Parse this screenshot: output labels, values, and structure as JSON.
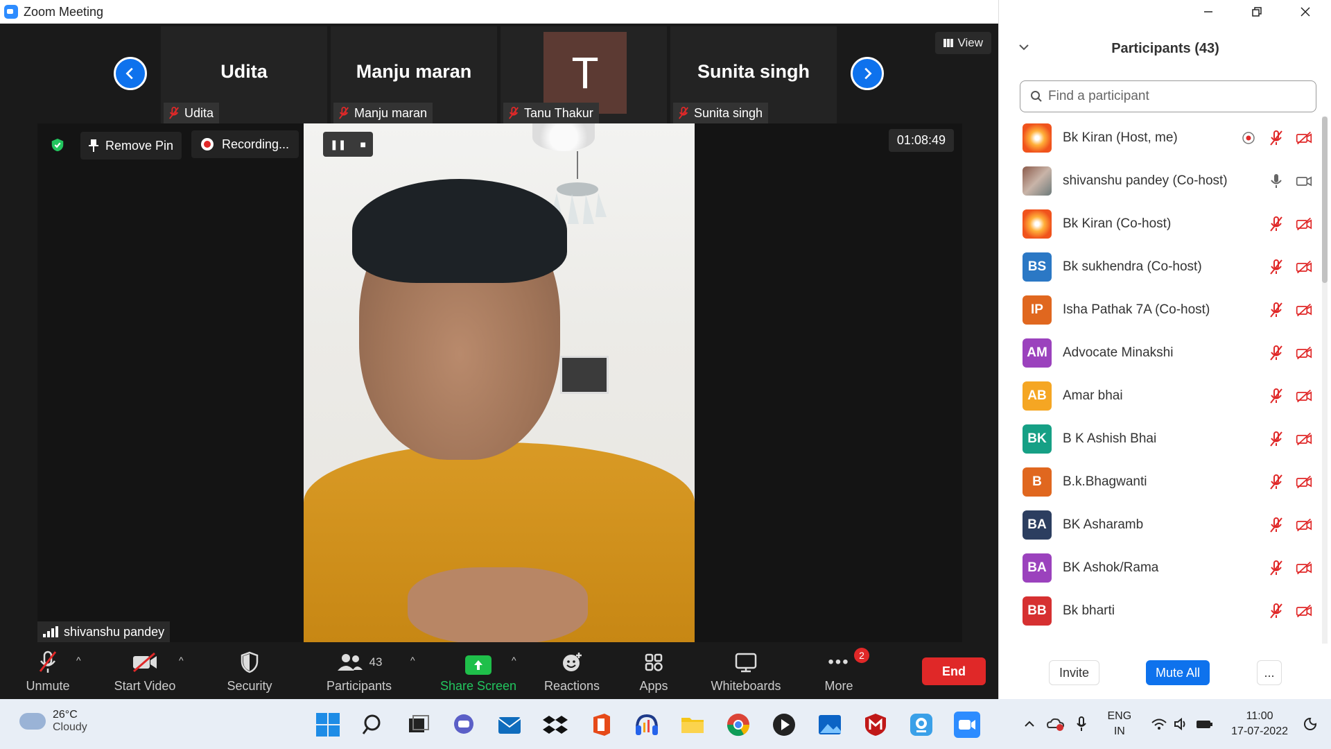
{
  "window": {
    "title": "Zoom Meeting"
  },
  "gallery": {
    "tiles": [
      {
        "big_name": "Udita",
        "label": "Udita"
      },
      {
        "big_name": "Manju maran",
        "label": "Manju maran"
      },
      {
        "avatar_letter": "T",
        "label": "Tanu Thakur"
      },
      {
        "big_name": "Sunita singh",
        "label": "Sunita singh"
      }
    ],
    "view_label": "View"
  },
  "speaker": {
    "remove_pin": "Remove Pin",
    "recording": "Recording...",
    "timer": "01:08:49",
    "name": "shivanshu pandey"
  },
  "toolbar": {
    "unmute": "Unmute",
    "start_video": "Start Video",
    "security": "Security",
    "participants": "Participants",
    "participants_count": "43",
    "share_screen": "Share Screen",
    "reactions": "Reactions",
    "apps": "Apps",
    "whiteboards": "Whiteboards",
    "more": "More",
    "more_badge": "2",
    "end": "End"
  },
  "panel": {
    "title": "Participants (43)",
    "search_placeholder": "Find a participant",
    "participants": [
      {
        "name": "Bk Kiran (Host, me)",
        "initials": "",
        "color": "#f0531c",
        "avatar": "img1"
      },
      {
        "name": "shivanshu pandey (Co-host)",
        "initials": "",
        "color": "#8b5a4a",
        "avatar": "img2"
      },
      {
        "name": "Bk Kiran (Co-host)",
        "initials": "",
        "color": "#f0531c",
        "avatar": "img1"
      },
      {
        "name": "Bk sukhendra (Co-host)",
        "initials": "BS",
        "color": "#2b78c5"
      },
      {
        "name": "Isha Pathak 7A (Co-host)",
        "initials": "IP",
        "color": "#e0671f"
      },
      {
        "name": "Advocate Minakshi",
        "initials": "AM",
        "color": "#9b42bd"
      },
      {
        "name": "Amar bhai",
        "initials": "AB",
        "color": "#f5a623"
      },
      {
        "name": "B K Ashish Bhai",
        "initials": "BK",
        "color": "#16a085"
      },
      {
        "name": "B.k.Bhagwanti",
        "initials": "B",
        "color": "#e0671f"
      },
      {
        "name": "BK Asharamb",
        "initials": "BA",
        "color": "#2c3e60"
      },
      {
        "name": "BK Ashok/Rama",
        "initials": "BA",
        "color": "#9b42bd"
      },
      {
        "name": "Bk bharti",
        "initials": "BB",
        "color": "#d63031"
      }
    ],
    "invite": "Invite",
    "mute_all": "Mute All",
    "more": "..."
  },
  "taskbar": {
    "temp": "26°C",
    "weather": "Cloudy",
    "lang1": "ENG",
    "lang2": "IN",
    "time": "11:00",
    "date": "17-07-2022"
  },
  "colors": {
    "accent": "#0e72ed",
    "end_red": "#e02828",
    "share_green": "#1fbf4a"
  }
}
